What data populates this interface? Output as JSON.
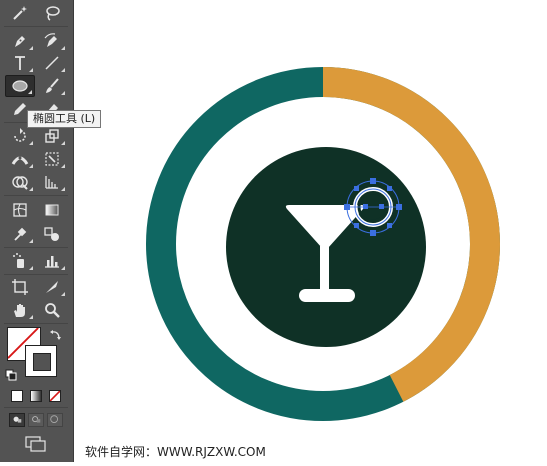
{
  "app": {
    "tooltip": "椭圆工具 (L)",
    "footer_text": "软件自学网：WWW.RJZXW.COM"
  },
  "colors": {
    "toolbar_bg": "#535353",
    "ring_orange": "#dc9a3a",
    "ring_teal": "#0f6762",
    "circle_dark": "#0f3126",
    "icon_white": "#ffffff",
    "selection_blue": "#3b6fe0"
  },
  "tools": [
    {
      "name": "magic-wand-tool-icon"
    },
    {
      "name": "lasso-tool-icon"
    },
    {
      "name": "pen-tool-icon"
    },
    {
      "name": "curvature-tool-icon"
    },
    {
      "name": "type-tool-icon"
    },
    {
      "name": "line-segment-tool-icon"
    },
    {
      "name": "ellipse-tool-icon",
      "active": true
    },
    {
      "name": "paintbrush-tool-icon"
    },
    {
      "name": "pencil-tool-icon"
    },
    {
      "name": "eraser-tool-icon"
    },
    {
      "name": "rotate-tool-icon"
    },
    {
      "name": "scale-tool-icon"
    },
    {
      "name": "width-tool-icon"
    },
    {
      "name": "free-transform-tool-icon"
    },
    {
      "name": "shape-builder-tool-icon"
    },
    {
      "name": "perspective-grid-tool-icon"
    },
    {
      "name": "mesh-tool-icon"
    },
    {
      "name": "gradient-tool-icon"
    },
    {
      "name": "eyedropper-tool-icon"
    },
    {
      "name": "blend-tool-icon"
    },
    {
      "name": "symbol-sprayer-tool-icon"
    },
    {
      "name": "column-graph-tool-icon"
    },
    {
      "name": "artboard-tool-icon"
    },
    {
      "name": "slice-tool-icon"
    },
    {
      "name": "hand-tool-icon"
    },
    {
      "name": "zoom-tool-icon"
    }
  ]
}
